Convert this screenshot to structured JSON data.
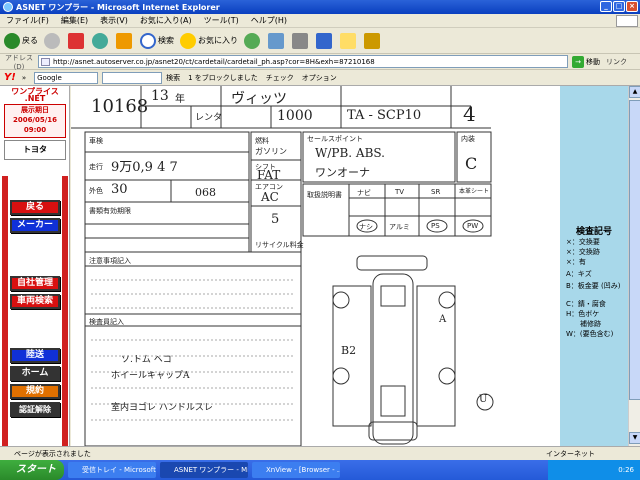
{
  "window": {
    "title": "ASNET ワンプラー - Microsoft Internet Explorer"
  },
  "menu": [
    "ファイル(F)",
    "編集(E)",
    "表示(V)",
    "お気に入り(A)",
    "ツール(T)",
    "ヘルプ(H)"
  ],
  "toolbar": {
    "back": "戻る",
    "search": "検索",
    "favorites": "お気に入り"
  },
  "address": {
    "label": "アドレス(D)",
    "url": "http://asnet.autoserver.co.jp/asnet20/ct/cardetail/cardetail_ph.asp?cor=8H&exh=87210168",
    "go": "移動",
    "links": "リンク"
  },
  "googlebar": {
    "brand": "Y!",
    "engine": "Google",
    "search": "検索",
    "blocked": "1 をブロックしました",
    "check": "チェック",
    "options": "オプション"
  },
  "sidebar": {
    "logo": "ワンプライス .NET",
    "date_label": "展示期日",
    "date": "2006/05/16",
    "time": "09:00",
    "maker": "トヨタ",
    "buttons": [
      "戻る",
      "メーカー",
      "自社管理",
      "車両検索",
      "陸送",
      "ホーム",
      "規約",
      "認証解除"
    ]
  },
  "sheet": {
    "lot": "10168",
    "year": "13",
    "era": "年",
    "model": "ヴィッツ",
    "rental": "レンタ",
    "cc": "1000",
    "trans_code": "TA - SCP10",
    "score": "4",
    "inspection_label": "車検",
    "mileage_label": "走行",
    "mileage": "9万0,9 4 7",
    "color_label": "外色",
    "color": "30",
    "color_no": "068",
    "registration_label": "書類有効期限",
    "fuel_label": "燃料",
    "fuel": "ガソリン",
    "shift_label": "シフト",
    "shift": "FAT",
    "ac_label": "エアコン",
    "ac": "AC",
    "seats": "5",
    "sales_point_label": "セールスポイント",
    "sales_point": "W/PB. ABS.",
    "owner": "ワンオーナ",
    "interior_label": "内装",
    "interior": "C",
    "records_label": "取扱説明書",
    "equipment": [
      "ナビ",
      "TV",
      "SR",
      "本革シート"
    ],
    "equipment_values": [
      "ナシ",
      "アルミ",
      "PS",
      "PW"
    ],
    "recycle_label": "リサイクル料金",
    "notes_label": "注意事項記入",
    "inspector_notes_label": "検査員記入",
    "note_lines": [
      "ソ.トム  ヘコ",
      "ホイールキャップA",
      "室内ヨゴレ  ハンドルスレ"
    ],
    "diagram_marks": [
      "B2",
      "A",
      "U"
    ]
  },
  "legend": {
    "title": "検査記号",
    "items": [
      "×：交換要",
      "×：交換跡",
      "×：有",
      "A：キズ",
      "B：板金要 (凹み)",
      "C：錆・腐食",
      "H：色ボケ",
      "補修跡",
      "W：(要色含む)"
    ]
  },
  "status": {
    "text": "ページが表示されました",
    "zone": "インターネット"
  },
  "taskbar": {
    "start": "スタート",
    "tasks": [
      "受信トレイ - Microsoft...",
      "ASNET ワンプラー - Mic...",
      "XnView - [Browser - ..."
    ],
    "time": "0:26"
  },
  "colors": {
    "legend_bg": "#a8d8ea",
    "red_button": "#d81010",
    "blue_button": "#1030d8"
  }
}
